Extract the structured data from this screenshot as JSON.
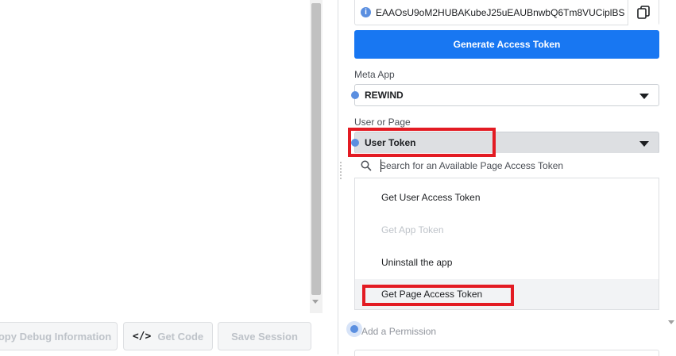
{
  "access_token": {
    "value": "EAAOsU9oM2HUBAKubeJ25uEAUBnwbQ6Tm8VUCiplBS",
    "info_icon": "info-icon",
    "copy_icon": "copy-icon"
  },
  "generate_button": "Generate Access Token",
  "meta_app": {
    "label": "Meta App",
    "selected": "REWIND"
  },
  "user_or_page": {
    "label": "User or Page",
    "selected": "User Token",
    "search_placeholder": "Search for an Available Page Access Token",
    "options": [
      {
        "label": "Get User Access Token",
        "state": "enabled"
      },
      {
        "label": "Get App Token",
        "state": "disabled"
      },
      {
        "label": "Uninstall the app",
        "state": "enabled"
      },
      {
        "label": "Get Page Access Token",
        "state": "hovered"
      }
    ]
  },
  "add_permission": "Add a Permission",
  "bottom_toolbar": {
    "copy_debug": "opy Debug Information",
    "get_code": "Get Code",
    "save_session": "Save Session"
  },
  "colors": {
    "primary": "#1877f2",
    "highlight": "#e31b23",
    "dot": "#5b8fe0"
  }
}
